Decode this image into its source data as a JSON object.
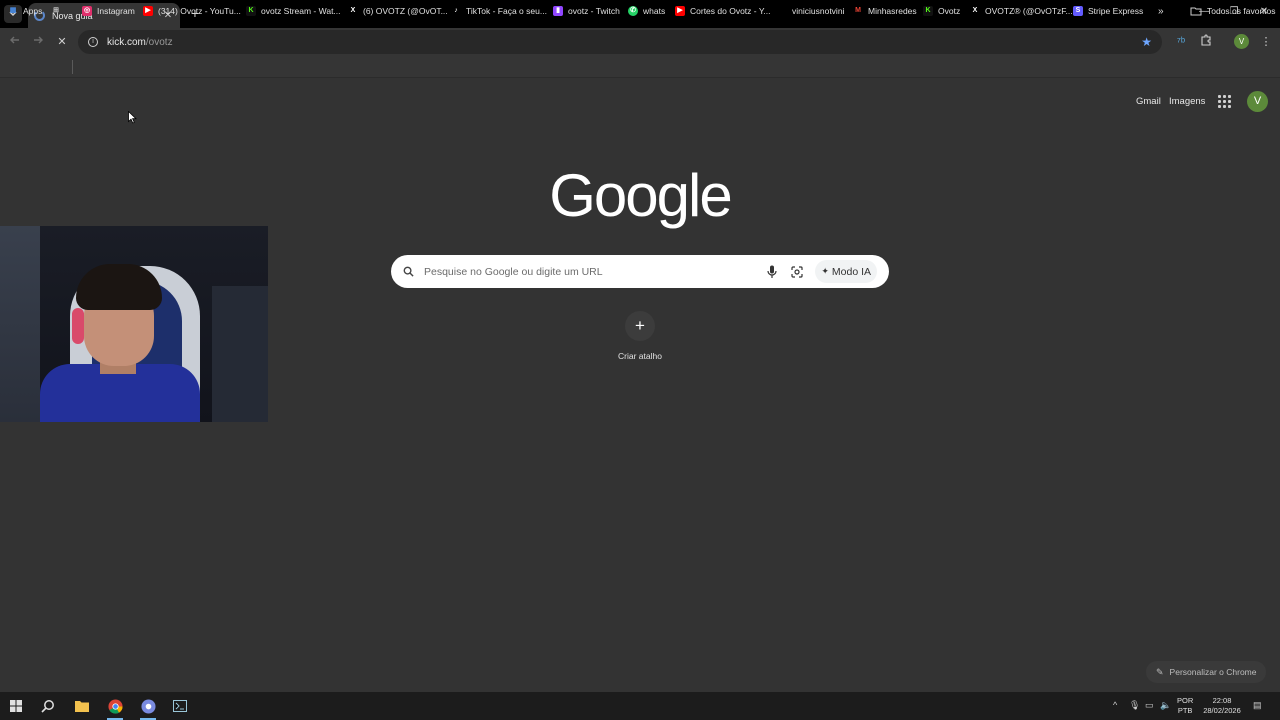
{
  "browser": {
    "tab": {
      "title": "Nova guia"
    },
    "omnibox": {
      "url_host": "kick.com",
      "url_path": "/ovotz"
    }
  },
  "bookmarks": [
    {
      "label": "Apps",
      "icon": "apps-icon",
      "color": "#4a8ee8"
    },
    {
      "label": "Instagram",
      "icon": "instagram-icon",
      "color": "#e1306c"
    },
    {
      "label": "(314) Ovotz - YouTu...",
      "icon": "youtube-icon",
      "color": "#ff0000"
    },
    {
      "label": "ovotz Stream - Wat...",
      "icon": "kick-icon",
      "color": "#53fc18"
    },
    {
      "label": "(6) OVOTZ (@OvOT...",
      "icon": "x-icon",
      "color": "#000000"
    },
    {
      "label": "TikTok - Faça o seu...",
      "icon": "tiktok-icon",
      "color": "#000000"
    },
    {
      "label": "ovotz - Twitch",
      "icon": "twitch-icon",
      "color": "#9146ff"
    },
    {
      "label": "whats",
      "icon": "whatsapp-icon",
      "color": "#25d366"
    },
    {
      "label": "Cortes do Ovotz - Y...",
      "icon": "youtube-icon",
      "color": "#ff0000"
    },
    {
      "label": "viniciusnotvini",
      "icon": "site-icon",
      "color": "#555555"
    },
    {
      "label": "Minhasredes",
      "icon": "gmail-icon",
      "color": "#ea4335"
    },
    {
      "label": "Ovotz",
      "icon": "kick-icon",
      "color": "#53fc18"
    },
    {
      "label": "OVOTZ® (@OvOTzF...",
      "icon": "x-icon",
      "color": "#000000"
    },
    {
      "label": "Stripe Express",
      "icon": "stripe-icon",
      "color": "#635bff"
    }
  ],
  "bookmarks_more": "Todos os favoritos",
  "page": {
    "links": {
      "gmail": "Gmail",
      "images": "Imagens"
    },
    "avatar_letter": "V",
    "logo": "Google",
    "search": {
      "placeholder": "Pesquise no Google ou digite um URL",
      "ai_mode": "Modo IA"
    },
    "shortcut_label": "Criar atalho",
    "customize_label": "Personalizar o Chrome"
  },
  "taskbar": {
    "lang_line1": "POR",
    "lang_line2": "PTB",
    "time": "22:08",
    "date": "28/02/2026"
  },
  "colors": {
    "page_bg": "#333333",
    "accent": "#5c8a3a",
    "star": "#6ea6ff"
  }
}
